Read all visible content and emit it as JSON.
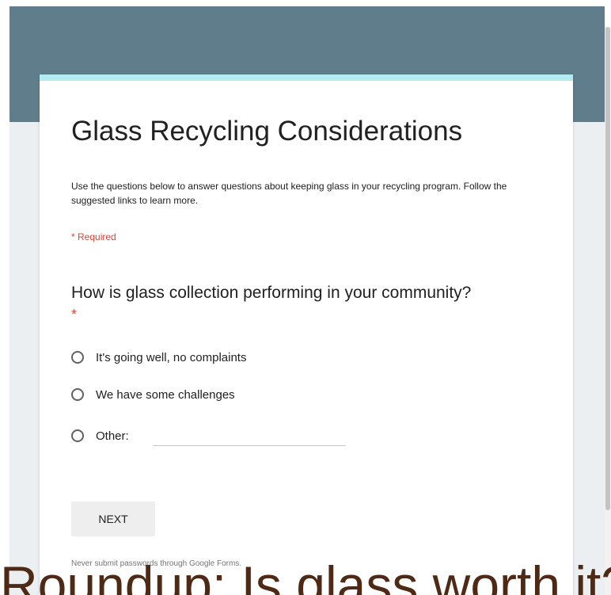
{
  "form": {
    "title": "Glass Recycling Considerations",
    "description": "Use the questions below to answer questions about keeping glass in your recycling program. Follow the suggested links to learn more.",
    "required_note": "* Required"
  },
  "question": {
    "title": "How is glass collection performing in your community?",
    "required_star": "*",
    "options": [
      {
        "label": "It's going well, no complaints",
        "selected": false
      },
      {
        "label": "We have some challenges",
        "selected": false
      },
      {
        "label": "Other:",
        "selected": false
      }
    ],
    "other_value": ""
  },
  "actions": {
    "next_label": "NEXT"
  },
  "footer": {
    "note": "Never submit passwords through Google Forms."
  },
  "overlay": {
    "text": "Roundup: Is glass worth it?"
  },
  "colors": {
    "header": "#607d8b",
    "accent": "#b2ebf2",
    "required": "#db4437",
    "page_bg": "#eceff1"
  }
}
